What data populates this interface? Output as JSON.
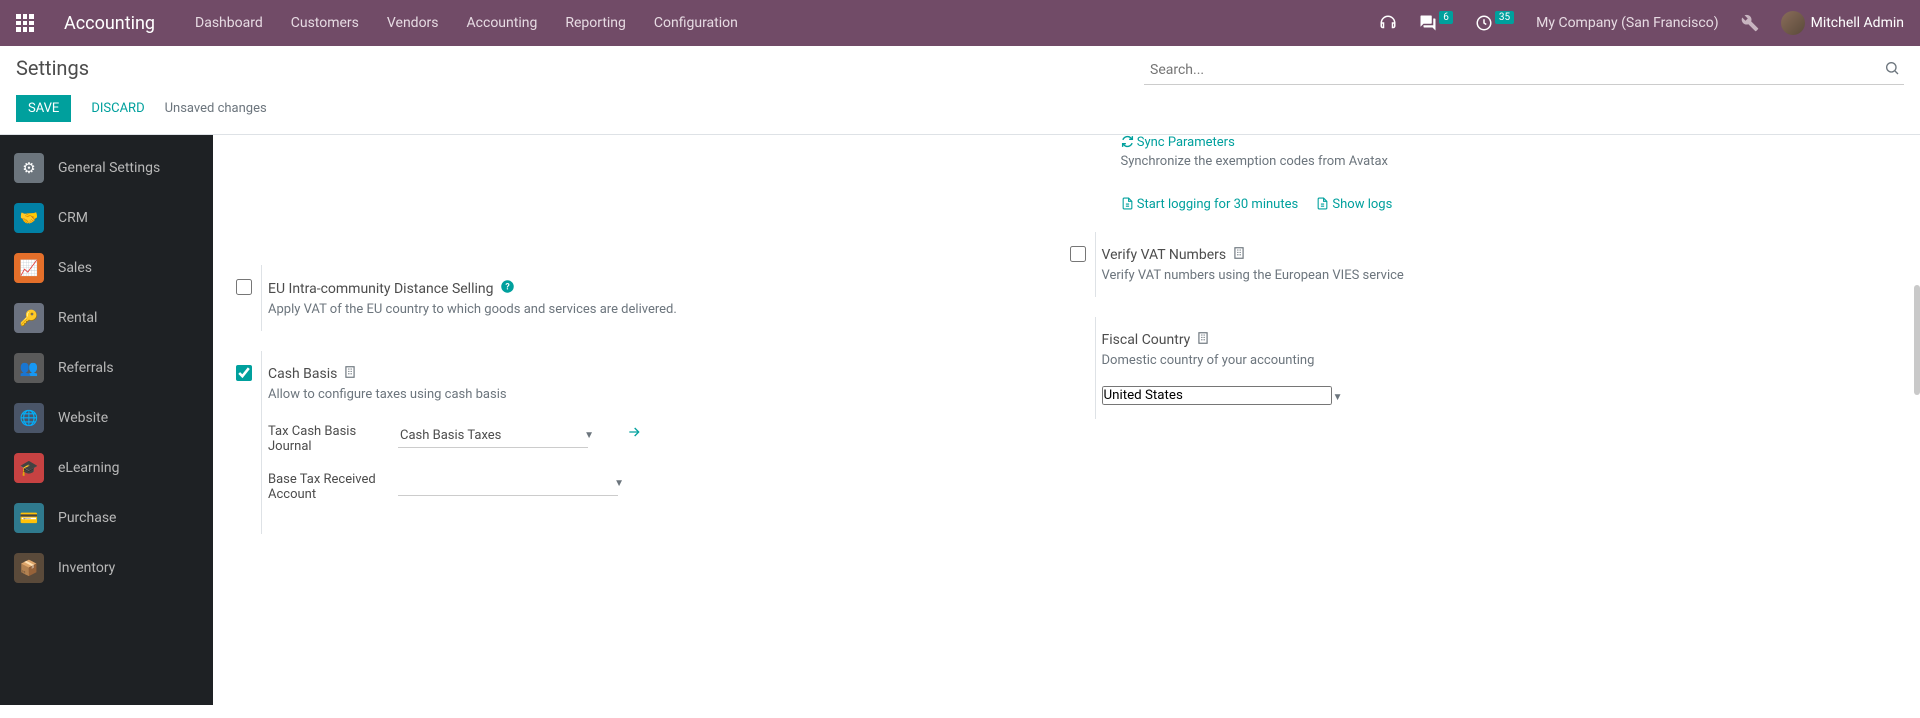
{
  "navbar": {
    "brand": "Accounting",
    "menu": [
      "Dashboard",
      "Customers",
      "Vendors",
      "Accounting",
      "Reporting",
      "Configuration"
    ],
    "messages_badge": "6",
    "activities_badge": "35",
    "company": "My Company (San Francisco)",
    "user": "Mitchell Admin"
  },
  "control": {
    "title": "Settings",
    "search_placeholder": "Search...",
    "save": "SAVE",
    "discard": "DISCARD",
    "unsaved": "Unsaved changes"
  },
  "sidebar": {
    "items": [
      {
        "label": "General Settings"
      },
      {
        "label": "CRM"
      },
      {
        "label": "Sales"
      },
      {
        "label": "Rental"
      },
      {
        "label": "Referrals"
      },
      {
        "label": "Website"
      },
      {
        "label": "eLearning"
      },
      {
        "label": "Purchase"
      },
      {
        "label": "Inventory"
      }
    ]
  },
  "right_col": {
    "sync_label": "Sync Parameters",
    "sync_desc": "Synchronize the exemption codes from Avatax",
    "start_logging": "Start logging for 30 minutes",
    "show_logs": "Show logs",
    "vat_title": "Verify VAT Numbers",
    "vat_desc": "Verify VAT numbers using the European VIES service",
    "fiscal_title": "Fiscal Country",
    "fiscal_desc": "Domestic country of your accounting",
    "fiscal_value": "United States"
  },
  "left_col": {
    "eu_title": "EU Intra-community Distance Selling",
    "eu_desc": "Apply VAT of the EU country to which goods and services are delivered.",
    "cash_title": "Cash Basis",
    "cash_desc": "Allow to configure taxes using cash basis",
    "journal_label": "Tax Cash Basis Journal",
    "journal_value": "Cash Basis Taxes",
    "base_label": "Base Tax Received Account",
    "base_value": ""
  }
}
